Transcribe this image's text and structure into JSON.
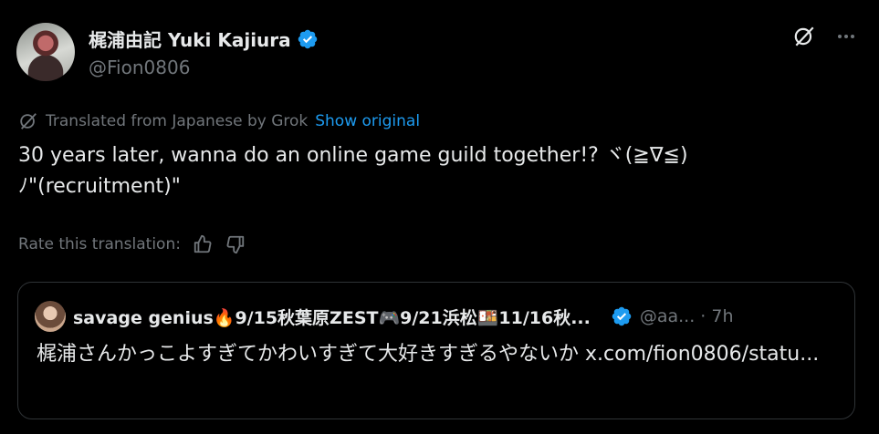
{
  "author": {
    "display_name": "梶浦由記 Yuki Kajiura",
    "handle": "@Fion0806",
    "avatar_icon": "profile-photo",
    "verified_icon": "verified-badge-icon",
    "verified_color": "#1d9bf0"
  },
  "actions": {
    "grok_icon": "grok-icon",
    "more_icon": "more-dots-icon"
  },
  "translation": {
    "notice": "Translated from Japanese by Grok",
    "show_original": "Show original",
    "icon": "grok-icon"
  },
  "tweet": {
    "text": "30 years later, wanna do an online game guild together!? ヾ(≧∇≦)\nﾉ\"(recruitment)\""
  },
  "rate": {
    "label": "Rate this translation:",
    "thumbs_up_icon": "thumbs-up-icon",
    "thumbs_down_icon": "thumbs-down-icon"
  },
  "quote": {
    "display_name": "savage genius🔥9/15秋葉原ZEST🎮9/21浜松🍱11/16秋...",
    "handle_time": "@aa... · 7h",
    "text_prefix": "梶浦さんかっこよすぎてかわいすぎて大好きすぎるやないか ",
    "link": "x.com/fion0806/statu...",
    "verified_icon": "verified-badge-icon"
  },
  "colors": {
    "background": "#000000",
    "text": "#e7e9ea",
    "muted": "#71767b",
    "accent": "#1d9bf0",
    "border": "#2f3336"
  }
}
